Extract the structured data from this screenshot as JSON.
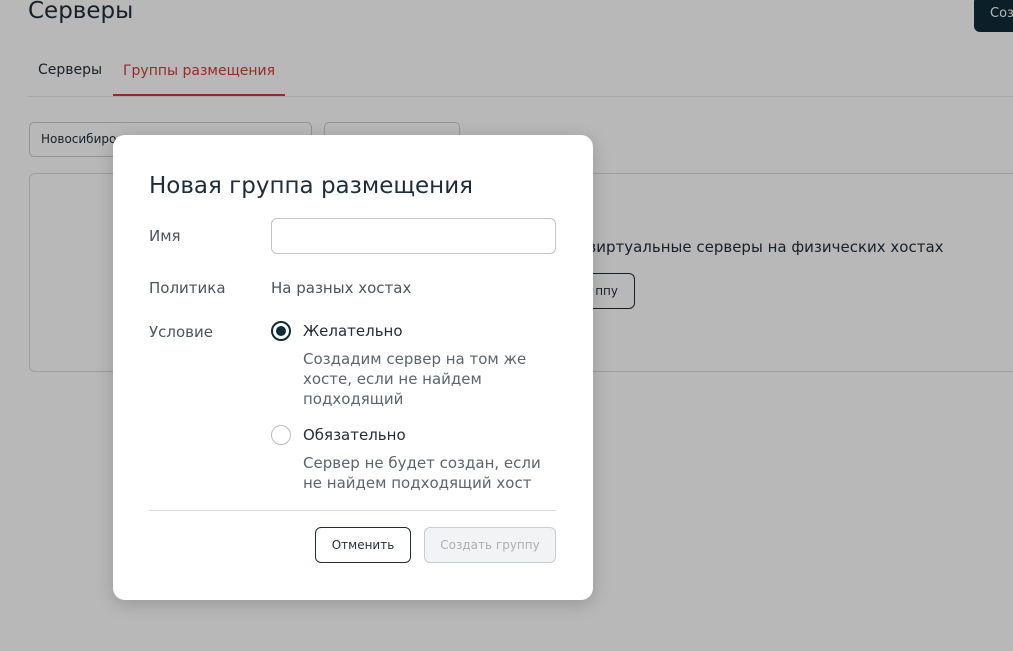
{
  "page": {
    "title": "Серверы",
    "create_button_label": "Соз"
  },
  "tabs": [
    {
      "label": "Серверы",
      "active": false
    },
    {
      "label": "Группы размещения",
      "active": true
    }
  ],
  "filters": {
    "region_value": "Новосибиро",
    "second_value": ""
  },
  "info_card": {
    "text": "олагать виртуальные серверы на физических хостах",
    "button_label": "ппу"
  },
  "modal": {
    "title": "Новая группа размещения",
    "name_label": "Имя",
    "name_value": "",
    "policy_label": "Политика",
    "policy_value": "На разных хостах",
    "condition_label": "Условие",
    "options": [
      {
        "label": "Желательно",
        "description": "Создадим сервер на том же хосте, если не найдем подходящий",
        "selected": true
      },
      {
        "label": "Обязательно",
        "description": "Сервер не будет создан, если не найдем подходящий хост",
        "selected": false
      }
    ],
    "cancel_label": "Отменить",
    "submit_label": "Создать группу",
    "submit_enabled": false
  },
  "colors": {
    "accent": "#d23b3b",
    "primary_dark": "#0f2b36",
    "text": "#1f2d3a",
    "overlay": "rgba(0,0,0,0.28)"
  }
}
